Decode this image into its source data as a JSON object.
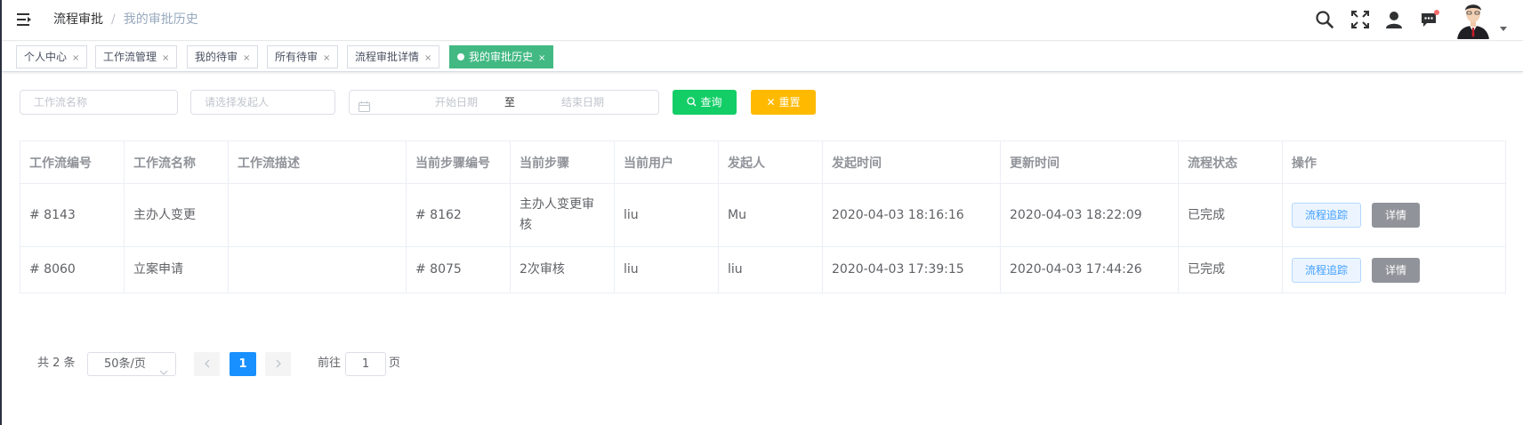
{
  "header": {
    "breadcrumb": [
      "流程审批",
      "我的审批历史"
    ],
    "menu_icon": "hamburger-menu-icon",
    "icons": [
      "search-icon",
      "fullscreen-icon",
      "user-icon",
      "message-icon"
    ],
    "notification_dot_color": "#f56c6c"
  },
  "tags": [
    {
      "label": "个人中心",
      "close": "×",
      "active": false
    },
    {
      "label": "工作流管理",
      "close": "×",
      "active": false
    },
    {
      "label": "我的待审",
      "close": "×",
      "active": false
    },
    {
      "label": "所有待审",
      "close": "×",
      "active": false
    },
    {
      "label": "流程审批详情",
      "close": "×",
      "active": false
    },
    {
      "label": "我的审批历史",
      "close": "×",
      "active": true
    }
  ],
  "filters": {
    "workflow_name_placeholder": "工作流名称",
    "initiator_placeholder": "请选择发起人",
    "start_date_placeholder": "开始日期",
    "range_separator": "至",
    "end_date_placeholder": "结束日期",
    "query_label": "查询",
    "reset_label": "重置"
  },
  "table": {
    "columns": [
      "工作流编号",
      "工作流名称",
      "工作流描述",
      "当前步骤编号",
      "当前步骤",
      "当前用户",
      "发起人",
      "发起时间",
      "更新时间",
      "流程状态",
      "操作"
    ],
    "rows": [
      {
        "id": "# 8143",
        "name": "主办人变更",
        "desc": "",
        "step_id": "# 8162",
        "step": "主办人变更审核",
        "current_user": "liu",
        "initiator": "Mu",
        "created": "2020-04-03 18:16:16",
        "updated": "2020-04-03 18:22:09",
        "status": "已完成"
      },
      {
        "id": "# 8060",
        "name": "立案申请",
        "desc": "",
        "step_id": "# 8075",
        "step": "2次审核",
        "current_user": "liu",
        "initiator": "liu",
        "created": "2020-04-03 17:39:15",
        "updated": "2020-04-03 17:44:26",
        "status": "已完成"
      }
    ],
    "action_track": "流程追踪",
    "action_detail": "详情"
  },
  "pagination": {
    "total": "共 2 条",
    "page_size": "50条/页",
    "current_page": "1",
    "goto_prefix": "前往",
    "goto_value": "1",
    "goto_suffix": "页"
  },
  "colors": {
    "active_tag": "#42b983",
    "query_button": "#13ce66",
    "reset_button": "#ffba00",
    "current_page": "#1890ff",
    "detail_button": "#909399"
  }
}
